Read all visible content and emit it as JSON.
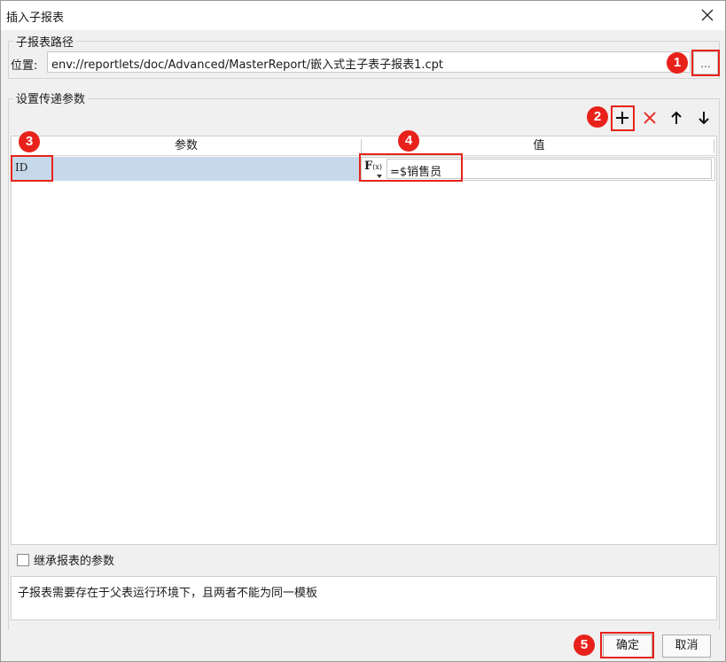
{
  "window": {
    "title": "插入子报表"
  },
  "path_group": {
    "legend": "子报表路径",
    "location_label": "位置:",
    "path_value": "env://reportlets/doc/Advanced/MasterReport/嵌入式主子表子报表1.cpt",
    "browse_label": "..."
  },
  "params_group": {
    "legend": "设置传递参数",
    "columns": [
      "参数",
      "值"
    ],
    "rows": [
      {
        "param": "ID",
        "fx_label": "F",
        "fx_sub": "(x)",
        "value": "=$销售员"
      }
    ]
  },
  "inherit_checkbox": {
    "label": "继承报表的参数",
    "checked": false
  },
  "note": "子报表需要存在于父表运行环境下，且两者不能为同一模板",
  "buttons": {
    "ok": "确定",
    "cancel": "取消"
  },
  "badges": [
    "1",
    "2",
    "3",
    "4",
    "5"
  ],
  "colors": {
    "accent_red": "#e8221b",
    "selected_row": "#c6d9ea"
  }
}
